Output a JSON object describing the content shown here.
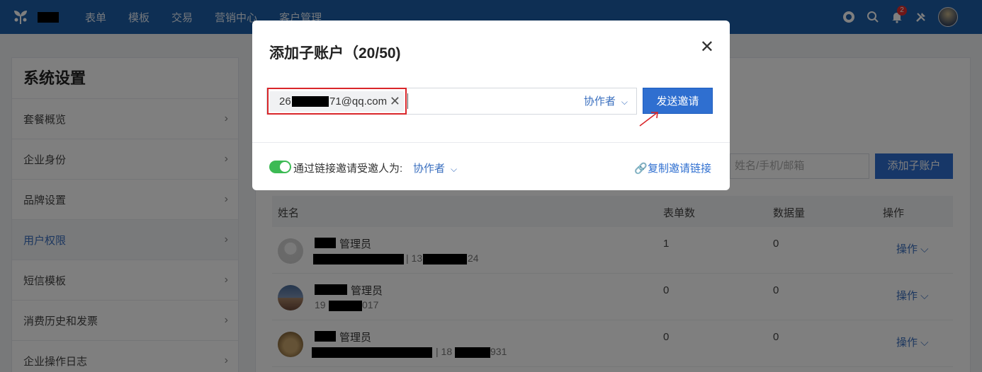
{
  "topbar": {
    "nav": [
      "表单",
      "模板",
      "交易",
      "营销中心",
      "客户管理"
    ],
    "notification_count": "2",
    "icons": [
      "help-icon",
      "search-icon",
      "bell-icon",
      "tools-icon",
      "avatar"
    ]
  },
  "sidebar": {
    "title": "系统设置",
    "items": [
      {
        "label": "套餐概览"
      },
      {
        "label": "企业身份"
      },
      {
        "label": "品牌设置"
      },
      {
        "label": "用户权限",
        "active": true
      },
      {
        "label": "短信模板"
      },
      {
        "label": "消费历史和发票"
      },
      {
        "label": "企业操作日志"
      }
    ]
  },
  "main": {
    "search_placeholder": "姓名/手机/邮箱",
    "add_button": "添加子账户",
    "columns": [
      "姓名",
      "表单数",
      "数据量",
      "操作"
    ],
    "rows": [
      {
        "role": "管理员",
        "contact_prefix": "| 13",
        "contact_suffix": "24",
        "forms": "1",
        "data": "0",
        "action": "操作"
      },
      {
        "role": "管理员",
        "contact_prefix": "19",
        "contact_suffix": "017",
        "forms": "0",
        "data": "0",
        "action": "操作"
      },
      {
        "role": "管理员",
        "contact_prefix": "| 18",
        "contact_suffix": "931",
        "forms": "0",
        "data": "0",
        "action": "操作"
      }
    ]
  },
  "modal": {
    "title": "添加子账户（20/50)",
    "tag_prefix": "26",
    "tag_suffix": "71@qq.com",
    "role_select": "协作者",
    "send_button": "发送邀请",
    "link_label": "通过链接邀请受邀人为:",
    "link_role": "协作者",
    "copy_link": "复制邀请链接",
    "toggle_on": true
  },
  "colors": {
    "topbar": "#1d5fa8",
    "primary": "#2f6fd0",
    "link": "#3a6fbf",
    "toggle": "#3cba54",
    "highlight_border": "#d9262a"
  }
}
